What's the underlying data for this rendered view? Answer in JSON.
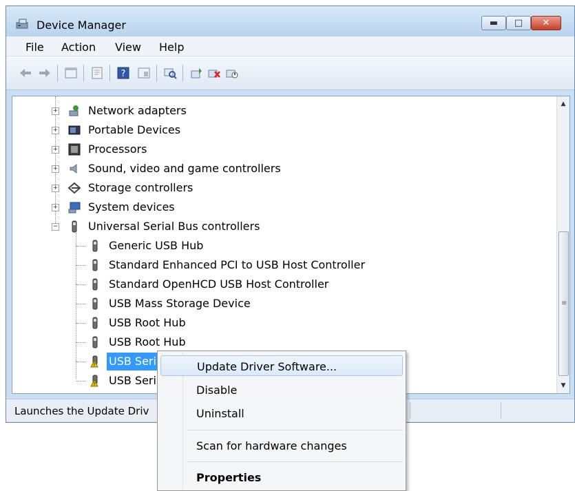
{
  "window": {
    "title": "Device Manager"
  },
  "menu": [
    "File",
    "Action",
    "View",
    "Help"
  ],
  "toolbar": {
    "icons": [
      "back-arrow-icon",
      "forward-arrow-icon",
      "show-hide-tree-icon",
      "properties-icon",
      "help-icon",
      "view-icon",
      "scan-hardware-icon",
      "update-driver-icon",
      "uninstall-icon",
      "disable-icon"
    ]
  },
  "tree": {
    "categories": [
      {
        "label": "Network adapters",
        "icon": "network-adapter-icon"
      },
      {
        "label": "Portable Devices",
        "icon": "portable-devices-icon"
      },
      {
        "label": "Processors",
        "icon": "processor-icon"
      },
      {
        "label": "Sound, video and game controllers",
        "icon": "speaker-icon"
      },
      {
        "label": "Storage controllers",
        "icon": "storage-controller-icon"
      },
      {
        "label": "System devices",
        "icon": "system-devices-icon"
      },
      {
        "label": "Universal Serial Bus controllers",
        "icon": "usb-icon"
      }
    ],
    "usb_children": [
      {
        "label": "Generic USB Hub",
        "warning": false
      },
      {
        "label": "Standard Enhanced PCI to USB Host Controller",
        "warning": false
      },
      {
        "label": "Standard OpenHCD USB Host Controller",
        "warning": false
      },
      {
        "label": "USB Mass Storage Device",
        "warning": false
      },
      {
        "label": "USB Root Hub",
        "warning": false
      },
      {
        "label": "USB Root Hub",
        "warning": false
      },
      {
        "label": "USB Serial",
        "warning": true,
        "selected": true
      },
      {
        "label": "USB Serial",
        "warning": true
      }
    ]
  },
  "status": {
    "text": "Launches the Update Driv"
  },
  "context_menu": {
    "items": [
      {
        "label": "Update Driver Software...",
        "highlighted": true
      },
      {
        "label": "Disable"
      },
      {
        "label": "Uninstall"
      },
      {
        "label": "Scan for hardware changes"
      },
      {
        "label": "Properties",
        "bold": true
      }
    ]
  },
  "colors": {
    "selection": "#3399ff",
    "titlebar": "#c9dff3",
    "close_button": "#c5402b"
  }
}
